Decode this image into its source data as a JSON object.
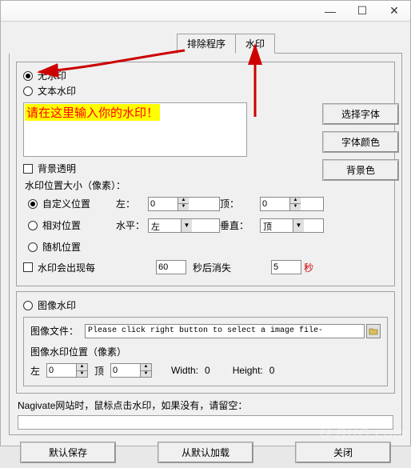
{
  "titlebar": {
    "minimize": "—",
    "maximize": "☐",
    "close": "✕"
  },
  "tabs": {
    "exclude": "排除程序",
    "watermark": "水印"
  },
  "radios": {
    "none": "无水印",
    "text": "文本水印",
    "image": "图像水印"
  },
  "textareaPrompt": "请在这里输入你的水印！",
  "sideButtons": {
    "font": "选择字体",
    "fontColor": "字体颜色",
    "bgColor": "背景色"
  },
  "bgTransparent": "背景透明",
  "posSizeLabel": "水印位置大小（像素）：",
  "posRadios": {
    "custom": "自定义位置",
    "relative": "相对位置",
    "random": "随机位置"
  },
  "posLabels": {
    "left": "左：",
    "top": "顶：",
    "horiz": "水平：",
    "vert": "垂直："
  },
  "posValues": {
    "left": "0",
    "top": "0"
  },
  "comboValues": {
    "horiz": "左",
    "vert": "顶"
  },
  "appearEvery": "水印会出现每",
  "appearSeconds": "60",
  "disappearAfter": "秒后消失",
  "disappearSeconds": "5",
  "secUnit": "秒",
  "imageFileLabel": "图像文件：",
  "imageFilePlaceholder": "Please click right button to select a image file-",
  "imagePosLabel": "图像水印位置（像素）",
  "imagePos": {
    "leftLabel": "左",
    "left": "0",
    "topLabel": "顶",
    "top": "0",
    "widthLabel": "Width:",
    "width": "0",
    "heightLabel": "Height:",
    "height": "0"
  },
  "navLabel": "Nagivate网站时，鼠标点击水印，如果没有，请留空：",
  "footer": {
    "saveDefault": "默认保存",
    "loadDefault": "从默认加载",
    "close": "关闭"
  },
  "cornerMark": "U BUG.com"
}
